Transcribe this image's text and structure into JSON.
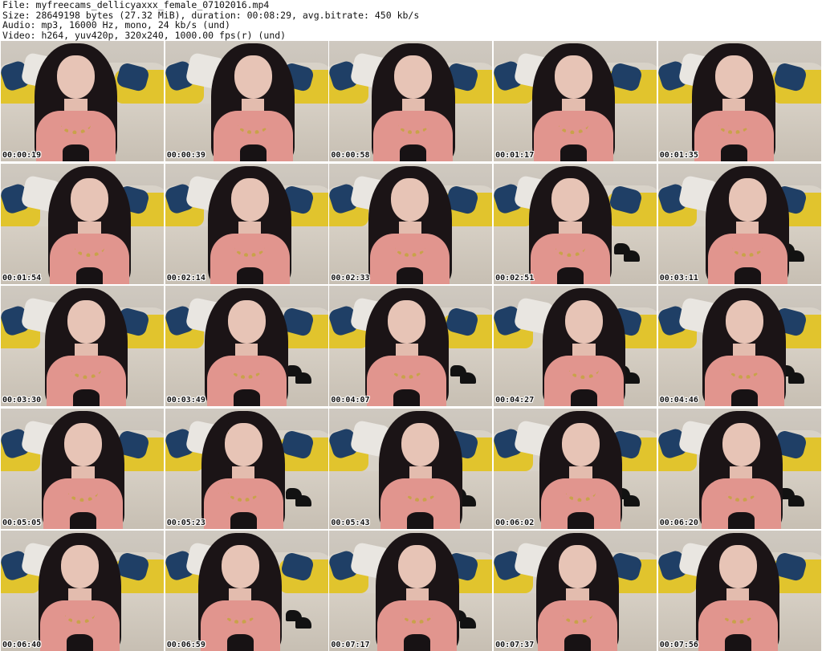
{
  "header": {
    "line1": "File: myfreecams_dellicyaxxx_female_07102016.mp4",
    "line2": "Size: 28649198 bytes (27.32 MiB), duration: 00:08:29, avg.bitrate: 450 kb/s",
    "line3": "Audio: mp3, 16000 Hz, mono, 24 kb/s (und)",
    "line4": "Video: h264, yuv420p, 320x240, 1000.00 fps(r) (und)"
  },
  "thumbnails": [
    {
      "timestamp": "00:00:19"
    },
    {
      "timestamp": "00:00:39"
    },
    {
      "timestamp": "00:00:58"
    },
    {
      "timestamp": "00:01:17"
    },
    {
      "timestamp": "00:01:35"
    },
    {
      "timestamp": "00:01:54"
    },
    {
      "timestamp": "00:02:14"
    },
    {
      "timestamp": "00:02:33"
    },
    {
      "timestamp": "00:02:51"
    },
    {
      "timestamp": "00:03:11"
    },
    {
      "timestamp": "00:03:30"
    },
    {
      "timestamp": "00:03:49"
    },
    {
      "timestamp": "00:04:07"
    },
    {
      "timestamp": "00:04:27"
    },
    {
      "timestamp": "00:04:46"
    },
    {
      "timestamp": "00:05:05"
    },
    {
      "timestamp": "00:05:23"
    },
    {
      "timestamp": "00:05:43"
    },
    {
      "timestamp": "00:06:02"
    },
    {
      "timestamp": "00:06:20"
    },
    {
      "timestamp": "00:06:40"
    },
    {
      "timestamp": "00:06:59"
    },
    {
      "timestamp": "00:07:17"
    },
    {
      "timestamp": "00:07:37"
    },
    {
      "timestamp": "00:07:56"
    }
  ],
  "colors": {
    "background": "#ffffff",
    "text": "#111111",
    "wall": "#cfc9c0",
    "sofa": "#d8d2c8",
    "pillow_blue": "#1f3f66",
    "pillow_yellow": "#e1c42d",
    "shirt_pink": "#e1958e",
    "hair": "#1b1416"
  }
}
